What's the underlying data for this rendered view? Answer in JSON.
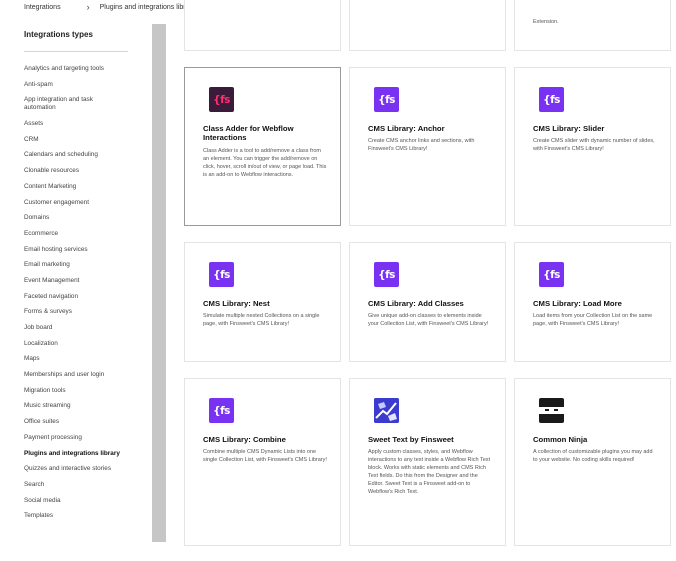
{
  "breadcrumb": {
    "root": "Integrations",
    "current": "Plugins and integrations library"
  },
  "sidebar": {
    "heading": "Integrations types",
    "items": [
      "Analytics and targeting tools",
      "Anti-spam",
      "App integration and task automation",
      "Assets",
      "CRM",
      "Calendars and scheduling",
      "Clonable resources",
      "Content Marketing",
      "Customer engagement",
      "Domains",
      "Ecommerce",
      "Email hosting services",
      "Email marketing",
      "Event Management",
      "Faceted navigation",
      "Forms & surveys",
      "Job board",
      "Localization",
      "Maps",
      "Memberships and user login",
      "Migration tools",
      "Music streaming",
      "Office suites",
      "Payment processing",
      "Plugins and integrations library",
      "Quizzes and interactive stories",
      "Search",
      "Social media",
      "Templates"
    ],
    "active_item": "Plugins and integrations library"
  },
  "top_partial_text": "Extension.",
  "cards": [
    {
      "logo_text": "{fs",
      "logo_icon": "finsweet-class-adder-logo",
      "title": "Class Adder for Webflow Interactions",
      "description": "Class Adder is a tool to add/remove a class from an element. You can trigger the add/remove on click, hover, scroll in/out of view, or page load. This is an add-on to Webflow interactions."
    },
    {
      "logo_text": "{fs",
      "logo_icon": "finsweet-logo",
      "title": "CMS Library: Anchor",
      "description": "Create CMS anchor links and sections, with Finsweet's CMS Library!"
    },
    {
      "logo_text": "{fs",
      "logo_icon": "finsweet-logo",
      "title": "CMS Library: Slider",
      "description": "Create CMS slider with dynamic number of slides, with Finsweet's CMS Library!"
    },
    {
      "logo_text": "{fs",
      "logo_icon": "finsweet-logo",
      "title": "CMS Library: Nest",
      "description": "Simulate multiple nested Collections on a single page, with Finsweet's CMS Library!"
    },
    {
      "logo_text": "{fs",
      "logo_icon": "finsweet-logo",
      "title": "CMS Library: Add Classes",
      "description": "Give unique add-on classes to elements inside your Collection List, with Finsweet's CMS Library!"
    },
    {
      "logo_text": "{fs",
      "logo_icon": "finsweet-logo",
      "title": "CMS Library: Load More",
      "description": "Load items from your Collection List on the same page, with Finsweet's CMS Library!"
    },
    {
      "logo_text": "{fs",
      "logo_icon": "finsweet-logo",
      "title": "CMS Library: Combine",
      "description": "Combine multiple CMS Dynamic Lists into one single Collection List, with Finsweet's CMS Library!"
    },
    {
      "logo_text": "",
      "logo_icon": "sweet-text-logo",
      "title": "Sweet Text by Finsweet",
      "description": "Apply custom classes, styles, and Webflow interactions to any text inside a Webflow Rich Text block. Works with static elements and CMS Rich Text fields. Do this from the Designer and the Editor. Sweet Text is a Finsweet add-on to Webflow's Rich Text."
    },
    {
      "logo_text": "",
      "logo_icon": "common-ninja-logo",
      "title": "Common Ninja",
      "description": "A collection of customizable plugins you may add to your website. No coding skills required!"
    }
  ],
  "colors": {
    "finsweet_purple": "#7a32f2",
    "class_adder_bg": "#3a1c3a",
    "class_adder_text": "#ff2f6e",
    "sweet_text_blue": "#3b3ccf",
    "ninja_black": "#1a1a1a"
  }
}
